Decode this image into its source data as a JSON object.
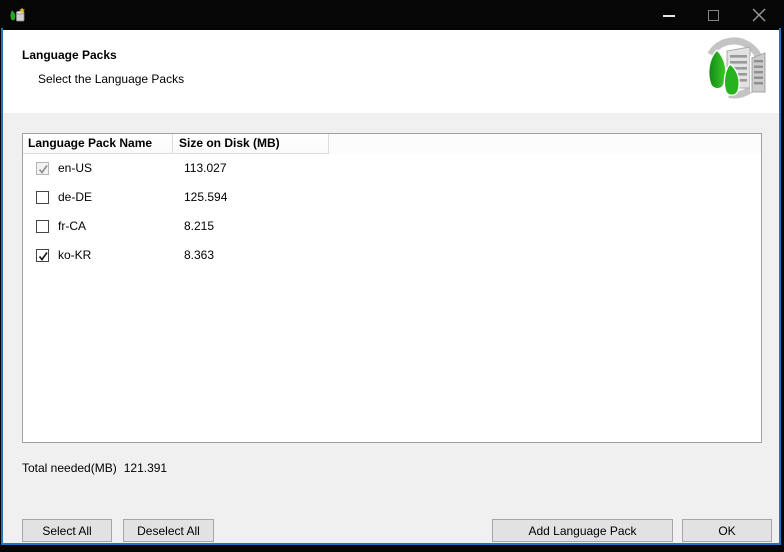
{
  "window": {
    "controls": {
      "minimize": "minimize",
      "maximize": "maximize",
      "close": "close"
    }
  },
  "header": {
    "title": "Language Packs",
    "subtitle": "Select the Language Packs"
  },
  "table": {
    "columns": [
      "Language Pack Name",
      "Size on Disk (MB)"
    ],
    "rows": [
      {
        "name": "en-US",
        "size_mb": "113.027",
        "checked": true,
        "disabled": true
      },
      {
        "name": "de-DE",
        "size_mb": "125.594",
        "checked": false,
        "disabled": false
      },
      {
        "name": "fr-CA",
        "size_mb": "8.215",
        "checked": false,
        "disabled": false
      },
      {
        "name": "ko-KR",
        "size_mb": "8.363",
        "checked": true,
        "disabled": false
      }
    ]
  },
  "summary": {
    "label": "Total needed(MB)",
    "value": "121.391"
  },
  "buttons": {
    "select_all": "Select All",
    "deselect_all": "Deselect All",
    "add_language_pack": "Add Language Pack",
    "ok": "OK"
  },
  "colors": {
    "accent_border": "#2273c3",
    "titlebar_bg": "#060606",
    "body_bg": "#f0f0f0",
    "header_band_bg": "#ffffff",
    "table_border": "#a0a0a0",
    "button_bg": "#e2e2e2",
    "button_border": "#a6a6a6",
    "tree_green": "#27b31f"
  }
}
